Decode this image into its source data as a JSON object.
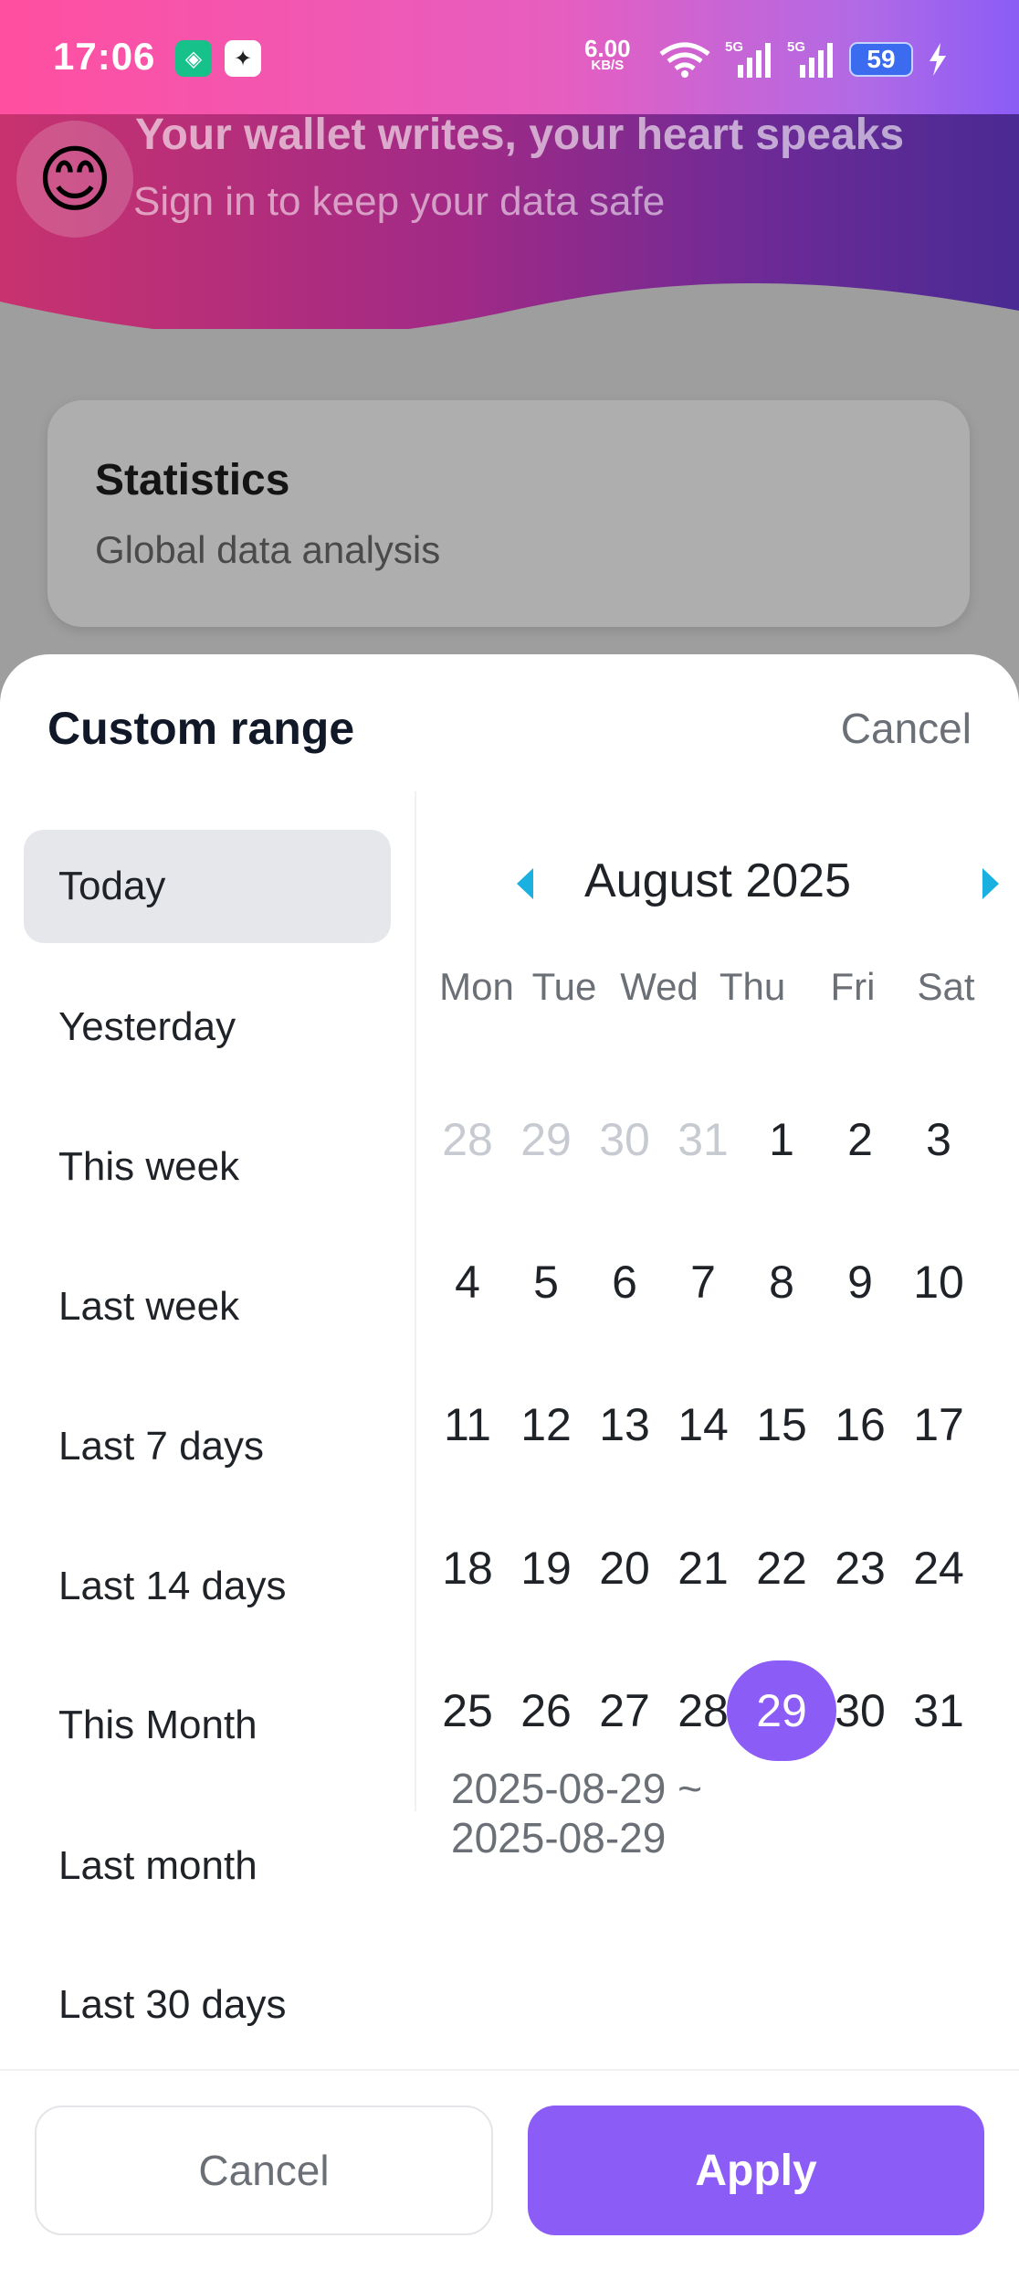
{
  "status_bar": {
    "time": "17:06",
    "speed_value": "6.00",
    "speed_unit": "KB/S",
    "network1": "5G",
    "network2": "5G",
    "battery": "59"
  },
  "header": {
    "avatar_emoji": "😊",
    "title": "Your wallet writes, your heart speaks",
    "subtitle": "Sign in to keep your data safe"
  },
  "stats_card": {
    "title": "Statistics",
    "subtitle": "Global data analysis"
  },
  "sheet": {
    "title": "Custom range",
    "cancel_label": "Cancel",
    "presets": [
      {
        "label": "Today",
        "active": true
      },
      {
        "label": "Yesterday",
        "active": false
      },
      {
        "label": "This week",
        "active": false
      },
      {
        "label": "Last week",
        "active": false
      },
      {
        "label": "Last 7 days",
        "active": false
      },
      {
        "label": "Last 14 days",
        "active": false
      },
      {
        "label": "This Month",
        "active": false
      },
      {
        "label": "Last month",
        "active": false
      },
      {
        "label": "Last 30 days",
        "active": false
      }
    ],
    "calendar": {
      "month_label": "August 2025",
      "weekdays": [
        "Mon",
        "Tue",
        "Wed",
        "Thu",
        "Fri",
        "Sat"
      ],
      "weeks": [
        [
          {
            "d": "28",
            "muted": true
          },
          {
            "d": "29",
            "muted": true
          },
          {
            "d": "30",
            "muted": true
          },
          {
            "d": "31",
            "muted": true
          },
          {
            "d": "1"
          },
          {
            "d": "2"
          },
          {
            "d": "3"
          }
        ],
        [
          {
            "d": "4"
          },
          {
            "d": "5"
          },
          {
            "d": "6"
          },
          {
            "d": "7"
          },
          {
            "d": "8"
          },
          {
            "d": "9"
          },
          {
            "d": "10"
          }
        ],
        [
          {
            "d": "11"
          },
          {
            "d": "12"
          },
          {
            "d": "13"
          },
          {
            "d": "14"
          },
          {
            "d": "15"
          },
          {
            "d": "16"
          },
          {
            "d": "17"
          }
        ],
        [
          {
            "d": "18"
          },
          {
            "d": "19"
          },
          {
            "d": "20"
          },
          {
            "d": "21"
          },
          {
            "d": "22"
          },
          {
            "d": "23"
          },
          {
            "d": "24"
          }
        ],
        [
          {
            "d": "25"
          },
          {
            "d": "26"
          },
          {
            "d": "27"
          },
          {
            "d": "28"
          },
          {
            "d": "29",
            "selected": true
          },
          {
            "d": "30"
          },
          {
            "d": "31"
          }
        ]
      ],
      "range_text": "2025-08-29 ~ 2025-08-29"
    },
    "footer": {
      "cancel_label": "Cancel",
      "apply_label": "Apply"
    }
  },
  "colors": {
    "accent": "#8b5cf6",
    "nav_arrow": "#1ab0e0",
    "active_preset_bg": "#e5e7eb"
  }
}
